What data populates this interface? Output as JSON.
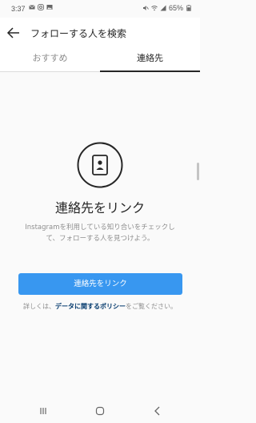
{
  "status_bar": {
    "time": "3:37",
    "battery_percent": "65%",
    "left_icons": [
      "mail-icon",
      "instagram-icon",
      "image-icon"
    ],
    "right_icons": [
      "mute-icon",
      "wifi-icon",
      "signal-icon",
      "battery-icon"
    ]
  },
  "header": {
    "title": "フォローする人を検索",
    "back_icon": "back-arrow-icon"
  },
  "tabs": [
    {
      "label": "おすすめ",
      "active": false
    },
    {
      "label": "連絡先",
      "active": true
    }
  ],
  "main": {
    "icon": "contact-book-icon",
    "heading": "連絡先をリンク",
    "description": "Instagramを利用している知り合いをチェックして、フォローする人を見つけよう。",
    "button_label": "連絡先をリンク",
    "policy_prefix": "詳しくは、",
    "policy_link": "データに関するポリシー",
    "policy_suffix": "をご覧ください。"
  },
  "nav_bar": {
    "icons": [
      "recents-icon",
      "home-icon",
      "back-icon"
    ]
  },
  "colors": {
    "accent": "#3897f0",
    "link": "#00376b",
    "text": "#262626",
    "secondary_text": "#8e8e8e",
    "background": "#fafafa"
  }
}
